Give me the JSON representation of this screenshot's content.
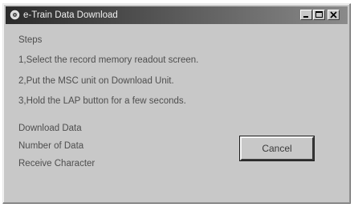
{
  "window": {
    "title": "e-Train Data Download",
    "app_icon": "app-gear-icon",
    "controls": {
      "minimize_icon": "minimize-icon",
      "maximize_icon": "maximize-icon",
      "close_icon": "close-icon"
    }
  },
  "steps": {
    "heading": "Steps",
    "items": [
      "1,Select the record memory readout screen.",
      "2,Put the MSC unit on Download Unit.",
      "3,Hold the LAP button for a few seconds."
    ]
  },
  "status": {
    "download_data_label": "Download Data",
    "number_of_data_label": "Number of Data",
    "receive_character_label": "Receive Character"
  },
  "buttons": {
    "cancel_label": "Cancel"
  }
}
